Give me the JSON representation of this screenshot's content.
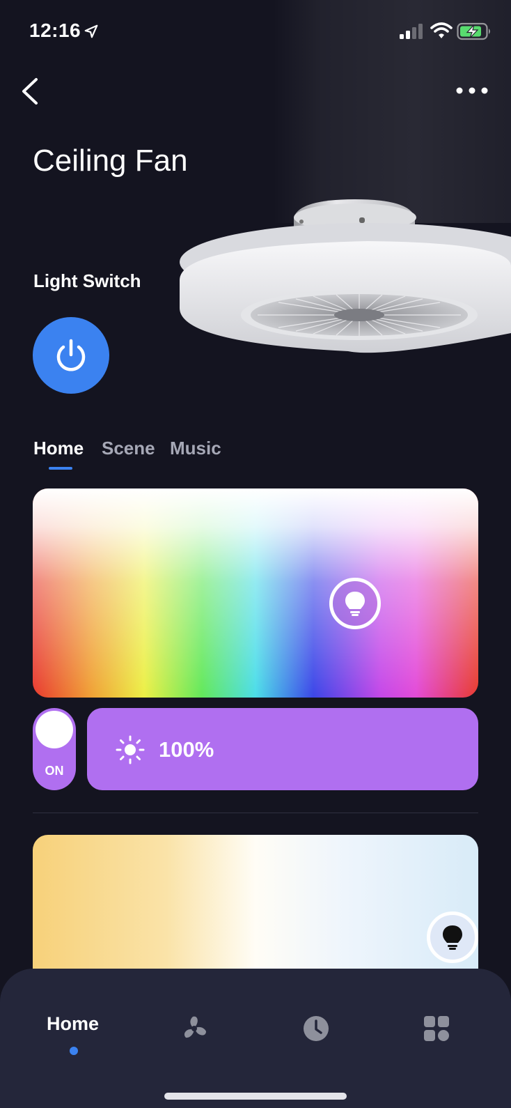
{
  "status_bar": {
    "time": "12:16",
    "icons": [
      "location-arrow-icon",
      "cellular-signal-icon",
      "wifi-icon",
      "battery-charging-icon"
    ]
  },
  "header": {
    "back_icon": "chevron-left-icon",
    "more_icon": "more-horizontal-icon",
    "title": "Ceiling Fan"
  },
  "light_switch": {
    "label": "Light Switch",
    "icon": "power-icon",
    "color": "#3b82f0"
  },
  "tabs": [
    {
      "label": "Home",
      "active": true
    },
    {
      "label": "Scene",
      "active": false
    },
    {
      "label": "Music",
      "active": false
    }
  ],
  "color_controls": {
    "color_picker_handle_icon": "lightbulb-icon",
    "toggle_label": "ON",
    "toggle_on": true,
    "brightness_icon": "sun-icon",
    "brightness": "100%",
    "accent_color": "#b06ff0"
  },
  "white_controls": {
    "temperature_handle_icon": "lightbulb-icon"
  },
  "bottom_nav": {
    "items": [
      {
        "label": "Home",
        "icon": null,
        "active": true
      },
      {
        "label": "",
        "icon": "fan-icon",
        "active": false
      },
      {
        "label": "",
        "icon": "clock-icon",
        "active": false
      },
      {
        "label": "",
        "icon": "grid-icon",
        "active": false
      }
    ]
  }
}
